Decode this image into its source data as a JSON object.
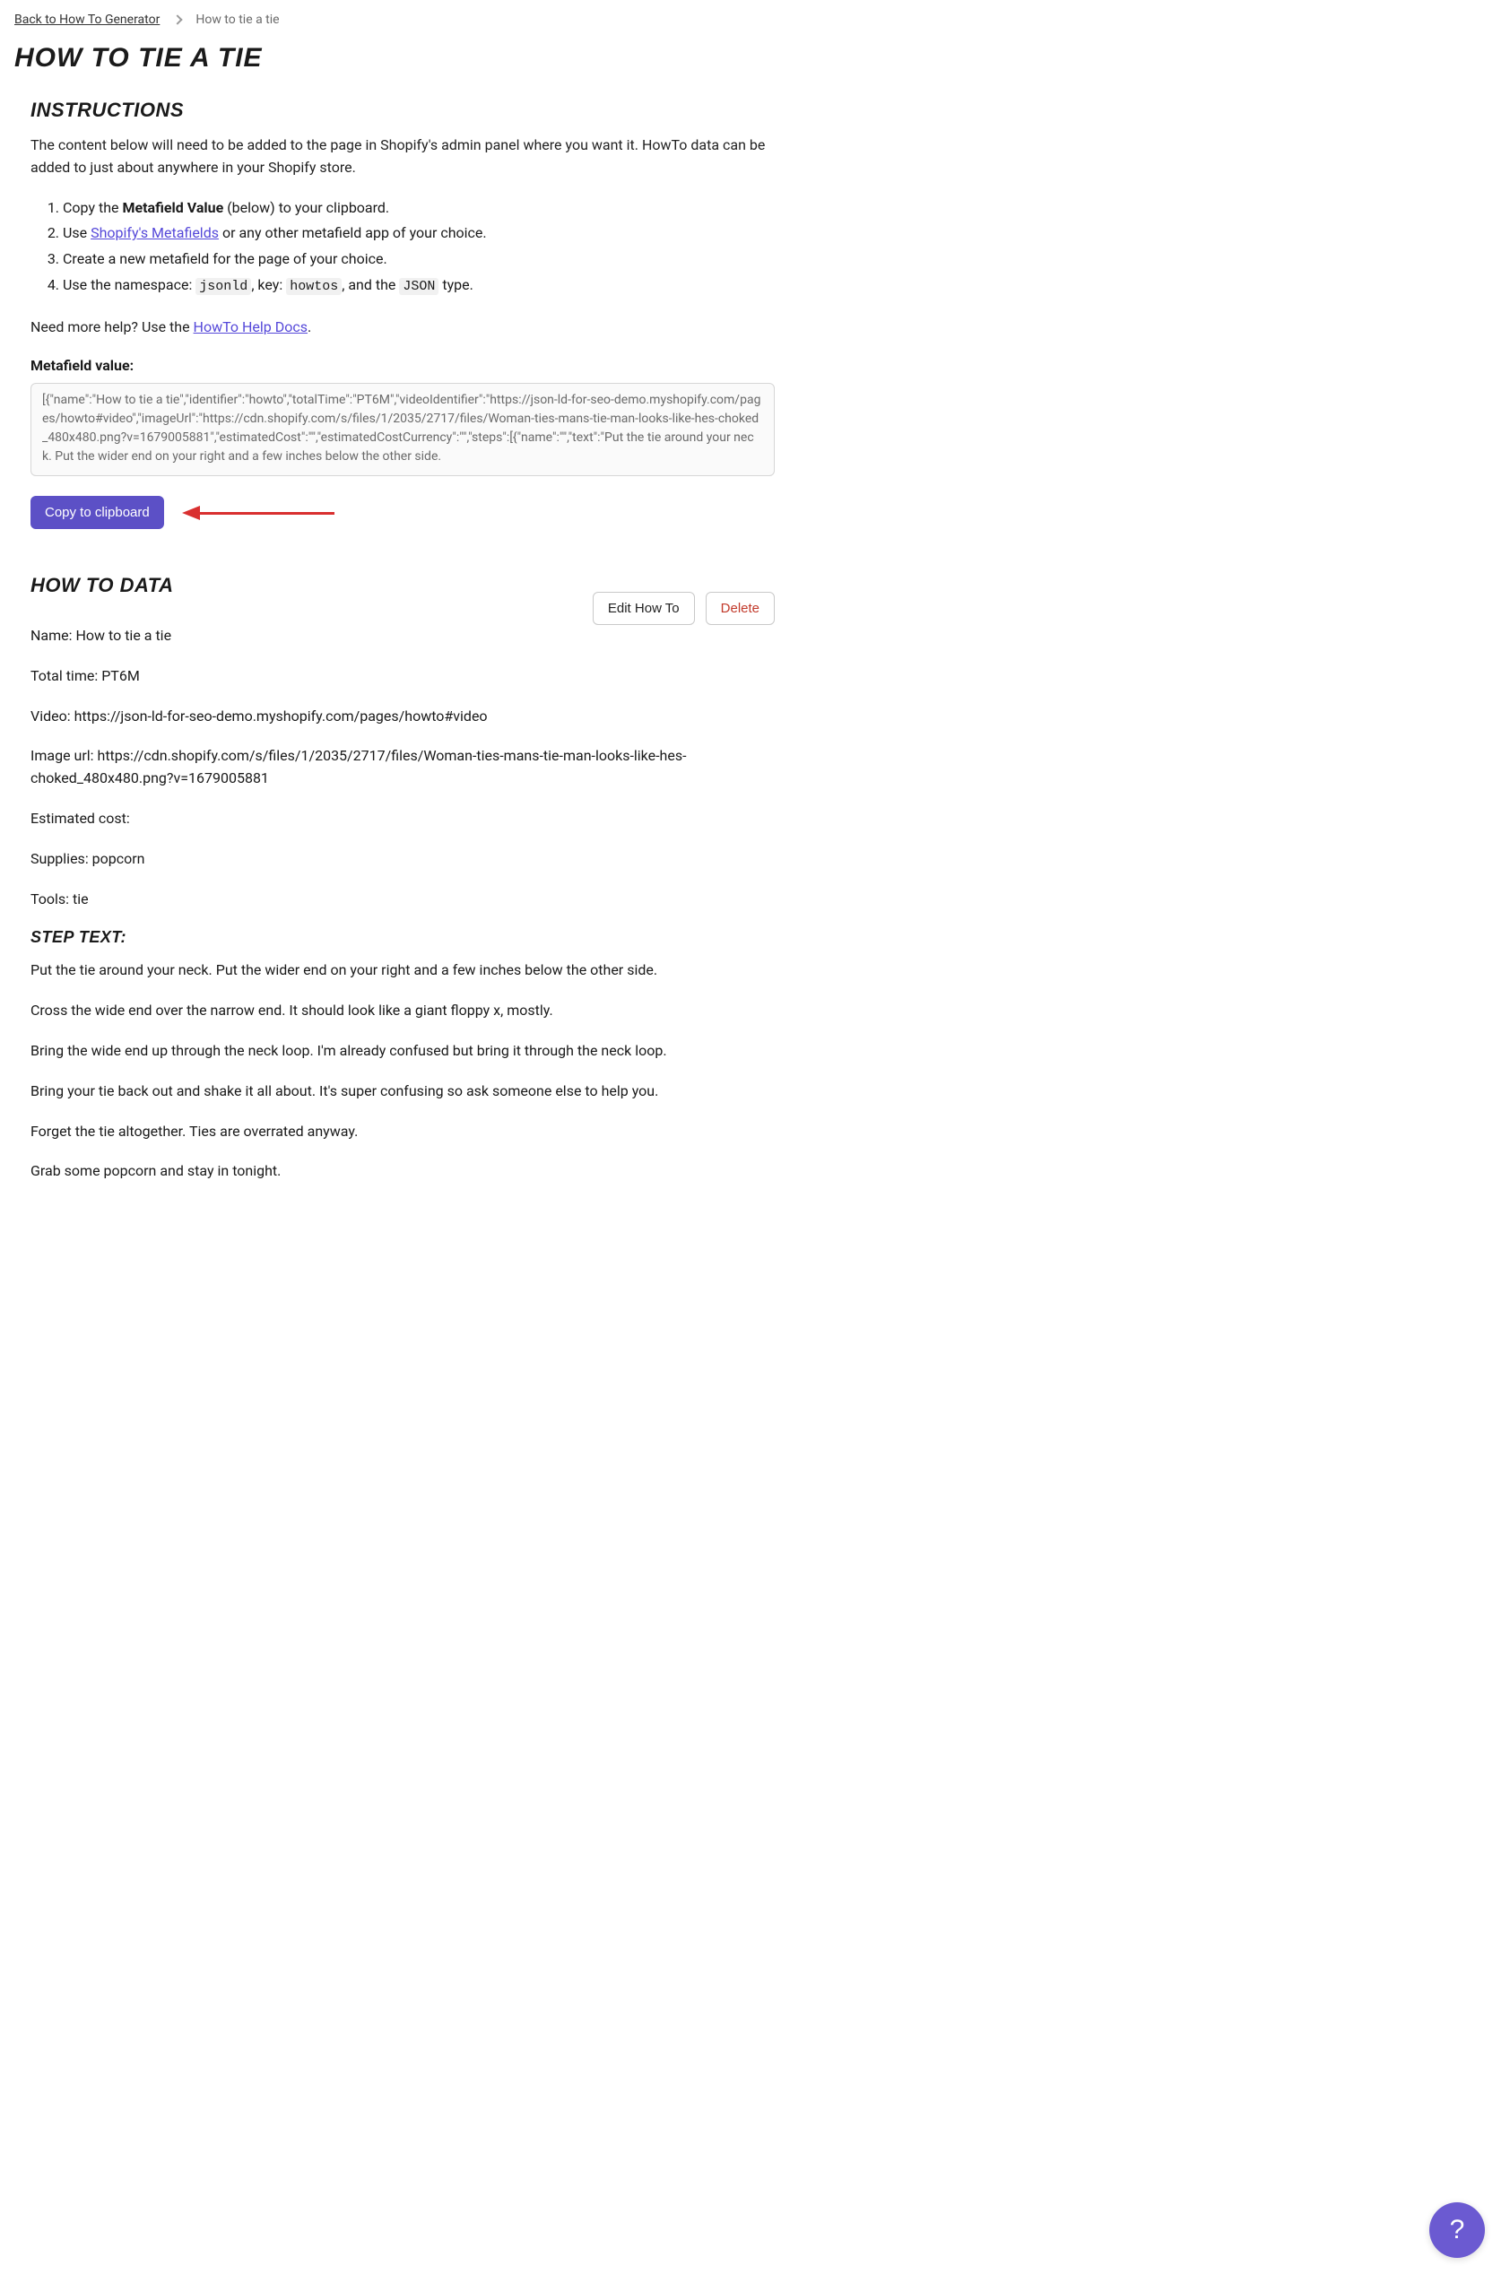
{
  "breadcrumb": {
    "back_label": "Back to How To Generator",
    "current": "How to tie a tie"
  },
  "page_title": "How to tie a tie",
  "instructions": {
    "heading": "Instructions",
    "intro": "The content below will need to be added to the page in Shopify's admin panel where you want it. HowTo data can be added to just about anywhere in your Shopify store.",
    "step1_a": "Copy the ",
    "step1_b": "Metafield Value",
    "step1_c": " (below) to your clipboard.",
    "step2_a": "Use ",
    "step2_link": "Shopify's Metafields",
    "step2_b": " or any other metafield app of your choice.",
    "step3": "Create a new metafield for the page of your choice.",
    "step4_a": "Use the namespace: ",
    "step4_ns": "jsonld",
    "step4_b": ", key: ",
    "step4_key": "howtos",
    "step4_c": ", and the ",
    "step4_type": "JSON",
    "step4_d": " type.",
    "help_a": "Need more help? Use the ",
    "help_link": "HowTo Help Docs",
    "help_b": ".",
    "metafield_label": "Metafield value:",
    "metafield_value": "[{\"name\":\"How to tie a tie\",\"identifier\":\"howto\",\"totalTime\":\"PT6M\",\"videoIdentifier\":\"https://json-ld-for-seo-demo.myshopify.com/pages/howto#video\",\"imageUrl\":\"https://cdn.shopify.com/s/files/1/2035/2717/files/Woman-ties-mans-tie-man-looks-like-hes-choked_480x480.png?v=1679005881\",\"estimatedCost\":\"\",\"estimatedCostCurrency\":\"\",\"steps\":[{\"name\":\"\",\"text\":\"Put the tie around your neck. Put the wider end on your right and a few inches below the other side.",
    "copy_button": "Copy to clipboard"
  },
  "howto": {
    "heading": "How to data",
    "edit_button": "Edit How To",
    "delete_button": "Delete",
    "name_label": "Name:",
    "name_value": "How to tie a tie",
    "total_time_label": "Total time:",
    "total_time_value": "PT6M",
    "video_label": "Video:",
    "video_value": "https://json-ld-for-seo-demo.myshopify.com/pages/howto#video",
    "image_label": "Image url:",
    "image_value": "https://cdn.shopify.com/s/files/1/2035/2717/files/Woman-ties-mans-tie-man-looks-like-hes-choked_480x480.png?v=1679005881",
    "cost_label": "Estimated cost:",
    "cost_value": "",
    "supplies_label": "Supplies:",
    "supplies_value": "popcorn",
    "tools_label": "Tools:",
    "tools_value": "tie",
    "step_heading": "Step text:",
    "steps": [
      "Put the tie around your neck. Put the wider end on your right and a few inches below the other side.",
      "Cross the wide end over the narrow end. It should look like a giant floppy x, mostly.",
      "Bring the wide end up through the neck loop. I'm already confused but bring it through the neck loop.",
      "Bring your tie back out and shake it all about. It's super confusing so ask someone else to help you.",
      "Forget the tie altogether. Ties are overrated anyway.",
      "Grab some popcorn and stay in tonight."
    ]
  },
  "help_fab": "?"
}
